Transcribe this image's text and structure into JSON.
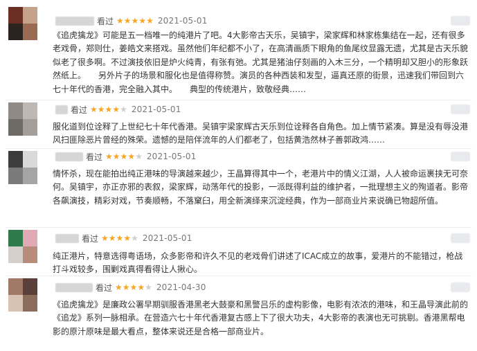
{
  "reviews": [
    {
      "rated_label": "看过",
      "rating": 5,
      "date": "2021-05-01",
      "text": "《追虎擒龙》可能是五一档唯一的纯港片了吧。4大影帝古天乐，吴镇宇，梁家辉和林家栋集结在一起，还有很多老戏骨，郑则仕，姜皓文来搭戏。虽然他们年纪都不小了，在高清画质下眼角的鱼尾纹显露无遗，尤其是古天乐貌似老了很多啊。不过演技依旧是炉火纯青，有张有弛。尤其是猪油仔刻画的入木三分，一个精明却又胆小的形象跃然纸上。　　另外片子的场景和服化也是值得称赞。演员的各种西装和发型，逼真还原的街景，迅速我们带回到六七十年代的香港，完全融入其中。　　典型的传统港片，致敬经典……",
      "colors": {
        "avatar": [
          "#6b2e23",
          "#c4a38a",
          "#2a2320",
          "#9a6a52"
        ]
      }
    },
    {
      "rated_label": "看过",
      "rating": 4,
      "date": "2021-05-01",
      "text": "服化道到位诠释了上世纪七十年代香港。吴镇宇梁家辉古天乐到位诠释各自角色。加上情节紧凑。算是没有辱没港风扫匪除恶片曾经的殊荣。遗憾的是陪伴流年的人们都老了，包括黄浩然林子善郭政鸿……",
      "colors": {
        "avatar": [
          "#8f8a86",
          "#bdb8b3",
          "#6e6a66",
          "#a39e99"
        ]
      }
    },
    {
      "rated_label": "看过",
      "rating": 4,
      "date": "2021-05-01",
      "text": "情怀杀，现在能拍出纯正港味的导演越来越少，王晶算得其中一个，老港片中的情义江湖，人人被命运裹挟无可奈何。吴镇宇，亦正亦邪的表叙，梁家辉，动荡年代的投影，一派既得利益的维护者，一批理想主义的殉道者。影帝各飙演技，精彩对戏，节奏顺畅，不落窠臼，用全新演绎来沉淀经典，作为一部商业片来说确已物超所值。",
      "colors": {
        "avatar": [
          "#3c3c3c",
          "#d9d9d9",
          "#7a7a7a",
          "#a5a5a5"
        ]
      }
    },
    {
      "rated_label": "看过",
      "rating": 4,
      "date": "2021-05-01",
      "text": "纯正港片，特意选得粤语场，众多影帝和许久不见的老戏骨们讲述了ICAC成立的故事，爱港片的不能错过，枪战打斗戏较多，围剿戏真得看得让人揪心。",
      "colors": {
        "avatar": [
          "#2f7a4a",
          "#e0a9b4",
          "#d6d0cc",
          "#b88c7a"
        ]
      }
    },
    {
      "rated_label": "看过",
      "rating": 4,
      "date": "2021-04-30",
      "text": "《追虎擒龙》是廉政公署早期驯服香港黑老大鼓豪和黑警吕乐的虚构影像，电影有浓浓的港味，和王晶导演此前的《追龙》系列一脉相承。在营造六七十年代香港复古感上下了很大功夫，4大影帝的表演也无可挑剔。香港黑帮电影的原汁原味是最大看点，整体来说还是合格一部商业片。",
      "colors": {
        "avatar": [
          "#a07a66",
          "#5b3f3a",
          "#d8c2b4",
          "#8c6d5c"
        ]
      }
    }
  ]
}
